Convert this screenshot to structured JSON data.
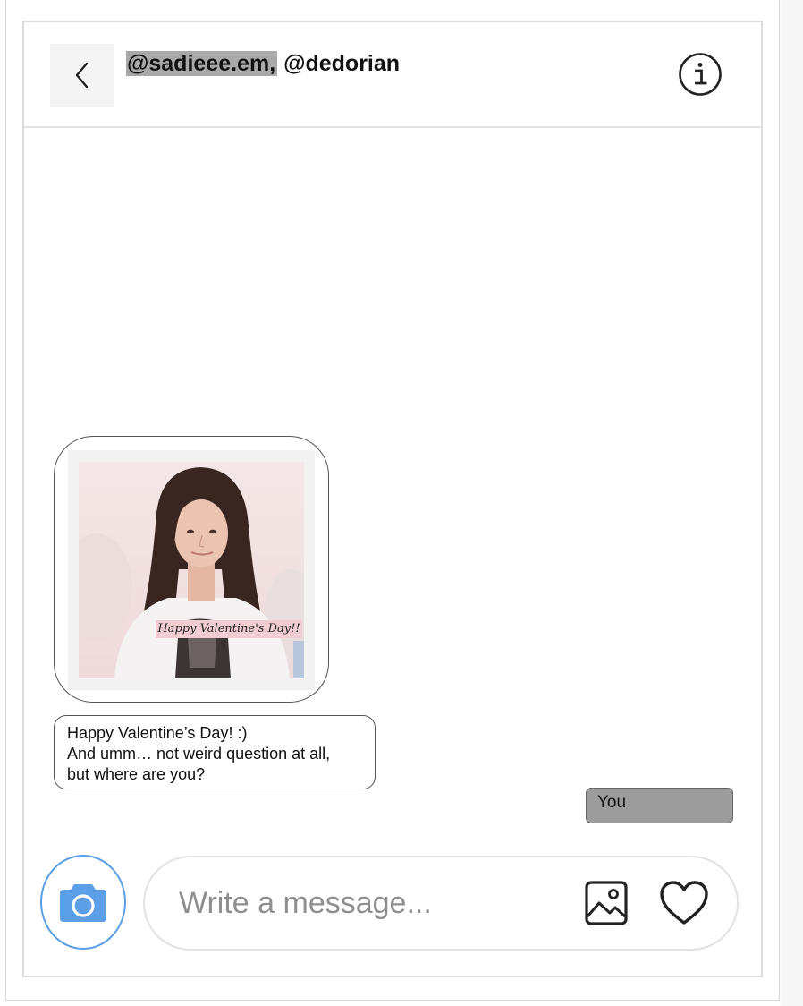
{
  "header": {
    "recipient_primary": "@sadieee.em,",
    "recipient_secondary": "@dedorian",
    "back_icon": "chevron-left-icon",
    "info_icon": "info-icon"
  },
  "messages": {
    "gif": {
      "caption": "Happy Valentine's Day!!"
    },
    "received_text": {
      "lines": [
        "Happy Valentine’s Day! :)",
        "And umm… not weird question at all,",
        "but where are you?"
      ]
    },
    "sent": {
      "label": "You"
    }
  },
  "composer": {
    "placeholder": "Write a message...",
    "value": "",
    "camera_icon": "camera-icon",
    "image_icon": "image-icon",
    "heart_icon": "heart-icon"
  },
  "colors": {
    "camera_accent": "#5aa0e8",
    "camera_fill": "#5d9fe6",
    "sent_bubble": "#9c9c9c",
    "title_highlight": "#a9a9a9"
  }
}
